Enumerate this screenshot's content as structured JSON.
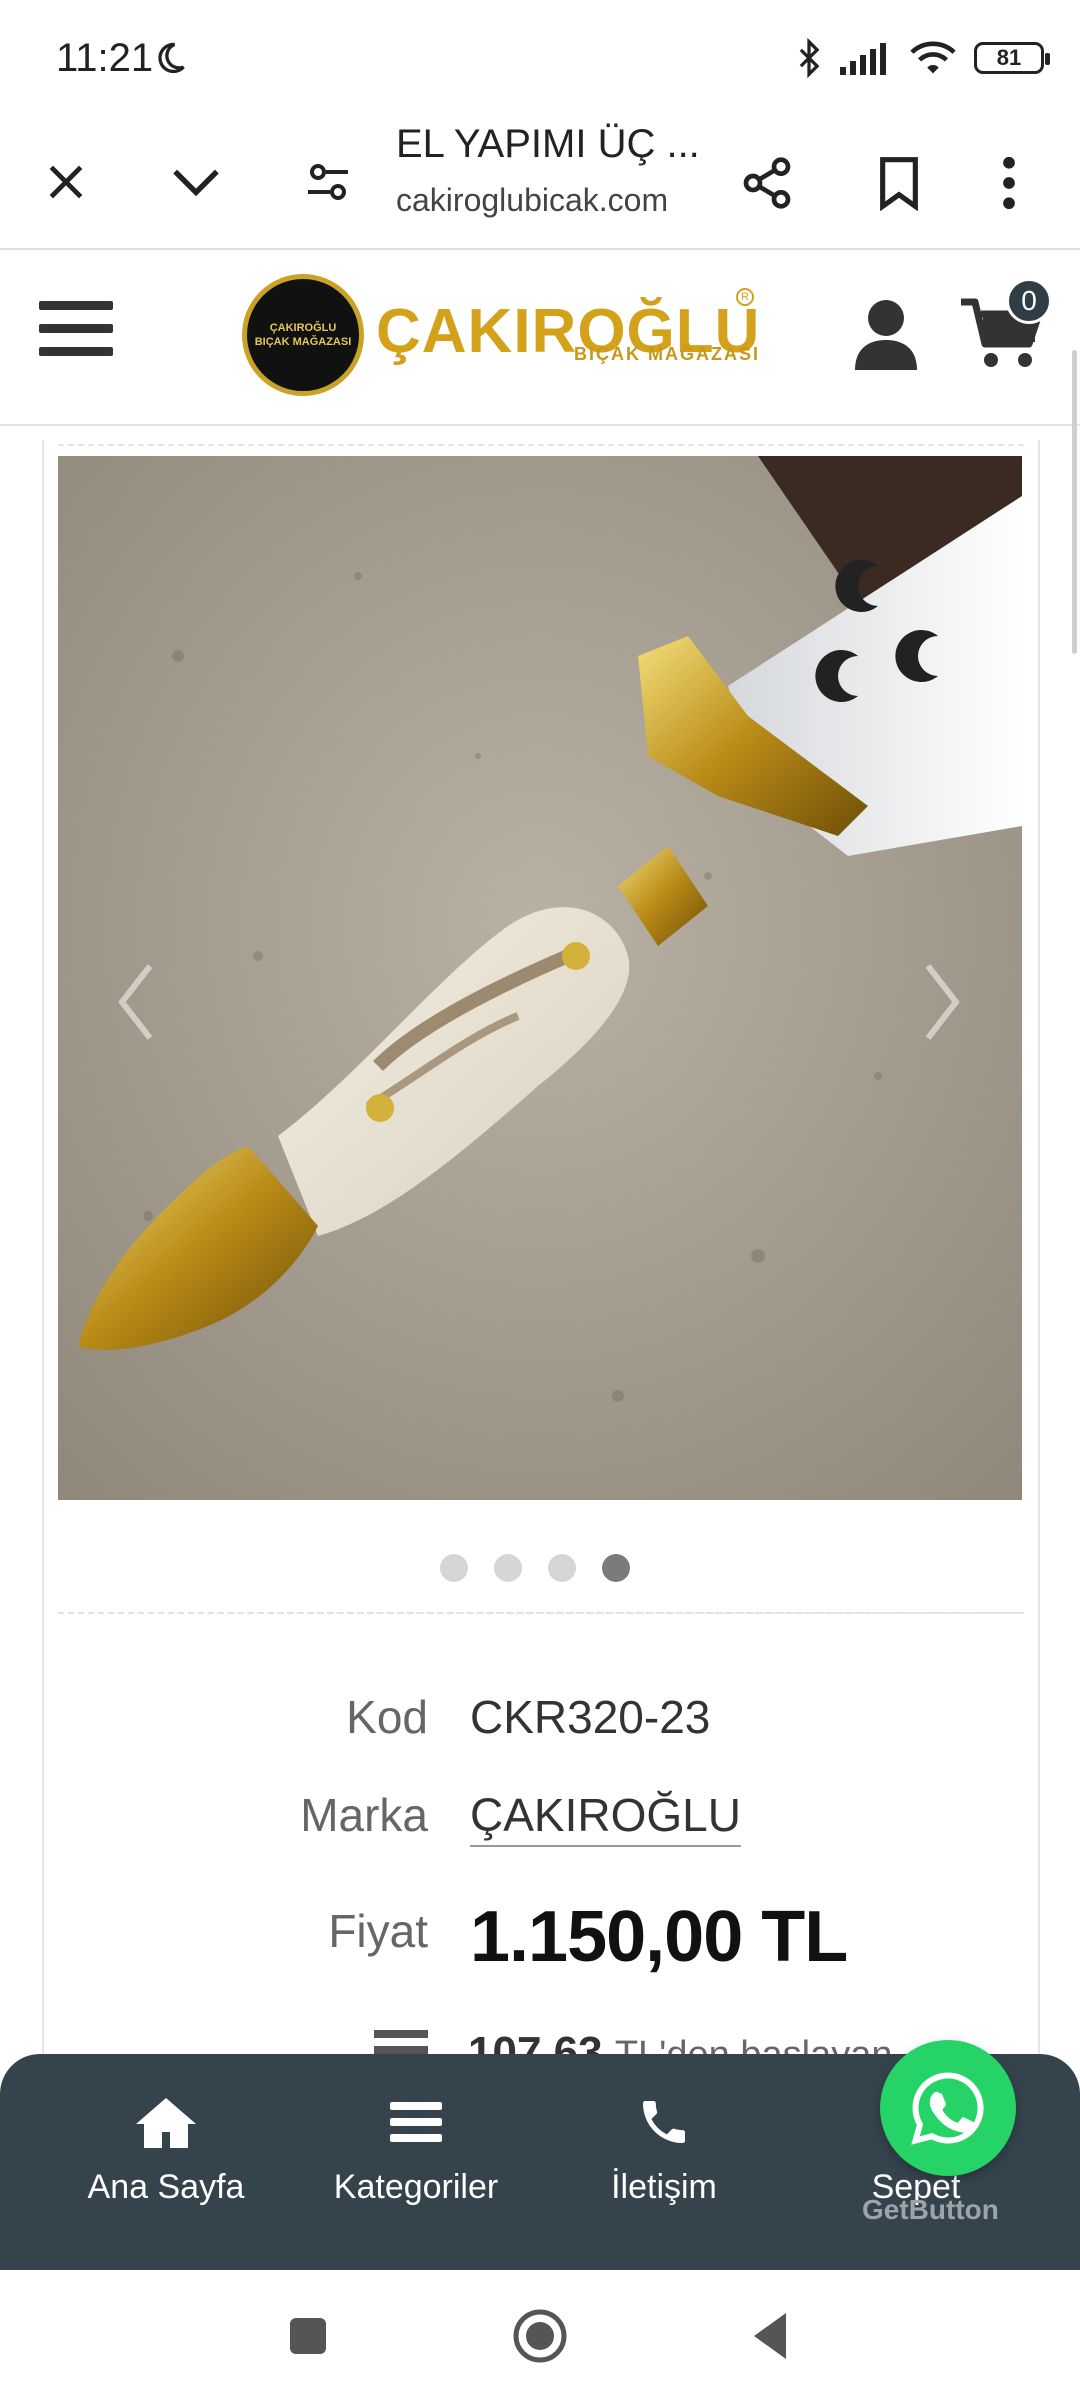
{
  "status_bar": {
    "time": "11:21",
    "battery": "81"
  },
  "browser": {
    "page_title": "EL YAPIMI ÜÇ ...",
    "url": "cakiroglubicak.com"
  },
  "site_header": {
    "logo_text": "ÇAKIROĞLU",
    "logo_subtitle": "BIÇAK MAĞAZASI",
    "logo_badge_line1": "ÇAKIROĞLU",
    "logo_badge_line2": "BIÇAK MAĞAZASI",
    "cart_count": "0"
  },
  "gallery": {
    "dots": 4,
    "active_index": 3
  },
  "product": {
    "code_label": "Kod",
    "code_value": "CKR320-23",
    "brand_label": "Marka",
    "brand_value": "ÇAKIROĞLU",
    "price_label": "Fiyat",
    "price_value": "1.150,00 TL",
    "installment_amount": "107,63",
    "installment_text": "TL'den başlayan"
  },
  "bottom_nav": {
    "items": [
      {
        "label": "Ana Sayfa",
        "icon": "home-icon"
      },
      {
        "label": "Kategoriler",
        "icon": "menu-icon"
      },
      {
        "label": "İletişim",
        "icon": "phone-icon"
      },
      {
        "label": "Sepet",
        "icon": "cart-icon"
      }
    ],
    "widget_brand": "GetButton"
  },
  "colors": {
    "brand_gold": "#d4a21a",
    "nav_bg": "#35434d",
    "whatsapp_green": "#25d366"
  }
}
